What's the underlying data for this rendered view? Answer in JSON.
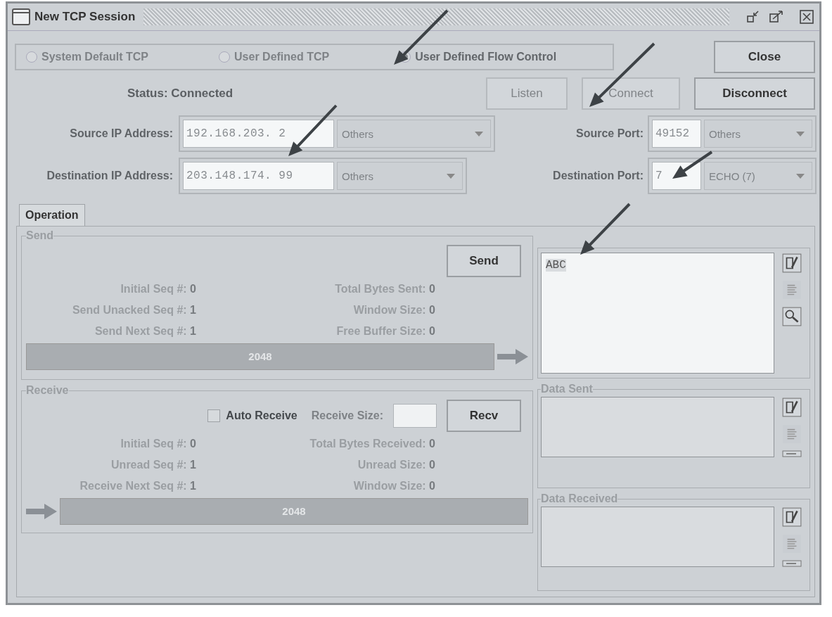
{
  "window": {
    "title": "New TCP Session"
  },
  "flow_modes": [
    {
      "label": "System Default TCP",
      "selected": false
    },
    {
      "label": "User Defined TCP",
      "selected": false
    },
    {
      "label": "User Defined Flow Control",
      "selected": true
    }
  ],
  "close_button": {
    "label": "Close",
    "disabled": false
  },
  "status": {
    "label": "Status:",
    "value": "Connected"
  },
  "connection_buttons": [
    {
      "label": "Listen",
      "disabled": true
    },
    {
      "label": "Connect",
      "disabled": true
    },
    {
      "label": "Disconnect",
      "disabled": false
    }
  ],
  "addresses": [
    {
      "label": "Source IP Address:",
      "value": "192.168.203. 2",
      "option": "Others"
    },
    {
      "label": "Destination IP Address:",
      "value": "203.148.174. 99",
      "option": "Others"
    }
  ],
  "ports": [
    {
      "label": "Source Port:",
      "value": "49152",
      "option": "Others"
    },
    {
      "label": "Destination Port:",
      "value": "7",
      "option": "ECHO (7)"
    }
  ],
  "tabs": [
    {
      "label": "Operation",
      "selected": true
    }
  ],
  "send": {
    "title": "Send",
    "button": "Send",
    "stats_left": [
      {
        "label": "Initial Seq #:",
        "value": "0"
      },
      {
        "label": "Send Unacked Seq #:",
        "value": "1"
      },
      {
        "label": "Send Next Seq #:",
        "value": "1"
      }
    ],
    "stats_right": [
      {
        "label": "Total Bytes Sent:",
        "value": "0"
      },
      {
        "label": "Window Size:",
        "value": "0"
      },
      {
        "label": "Free Buffer Size:",
        "value": "0"
      }
    ],
    "buffer": {
      "label": "2048",
      "level": 1
    },
    "text": "ABC"
  },
  "receive": {
    "title": "Receive",
    "auto_receive": {
      "label": "Auto Receive",
      "checked": false
    },
    "size_label": "Receive Size:",
    "button": "Recv",
    "stats_left": [
      {
        "label": "Initial Seq #:",
        "value": "0"
      },
      {
        "label": "Unread Seq #:",
        "value": "1"
      },
      {
        "label": "Receive Next Seq #:",
        "value": "1"
      }
    ],
    "stats_right": [
      {
        "label": "Total Bytes Received:",
        "value": "0"
      },
      {
        "label": "Unread Size:",
        "value": "0"
      },
      {
        "label": "Window Size:",
        "value": "0"
      }
    ],
    "buffer": {
      "label": "2048",
      "level": 1
    }
  },
  "data_sent": {
    "title": "Data Sent"
  },
  "data_received": {
    "title": "Data Received"
  }
}
